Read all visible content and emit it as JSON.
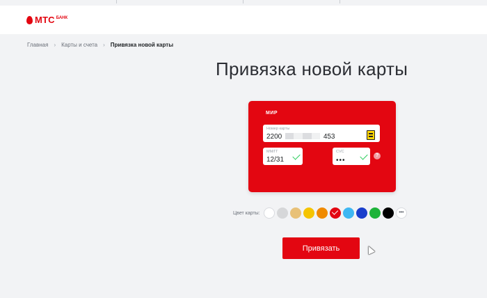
{
  "header": {
    "logo_text": "МТС",
    "logo_sub": "БАНК"
  },
  "breadcrumb": {
    "items": [
      "Главная",
      "Карты и счета"
    ],
    "current": "Привязка новой карты"
  },
  "page_title": "Привязка новой карты",
  "card": {
    "brand": "МИР",
    "number_label": "Номер карты",
    "number_start": "2200",
    "number_end": "453",
    "expiry_label": "ММ/ГГ",
    "expiry_value": "12/31",
    "cvc_label": "CVC",
    "cvc_value": "•••",
    "help_symbol": "?"
  },
  "card_color": {
    "label": "Цвет карты:",
    "swatches": [
      "#ffffff",
      "#d6d7d9",
      "#e8c178",
      "#f5c400",
      "#f08a00",
      "#e30611",
      "#3fb7f2",
      "#1a3fcc",
      "#1eb33a",
      "#000000"
    ],
    "selected_index": 5,
    "more_symbol": "•••"
  },
  "submit_label": "Привязать",
  "colors": {
    "brand_red": "#e30611",
    "background": "#f2f3f5",
    "success": "#26cd58"
  }
}
